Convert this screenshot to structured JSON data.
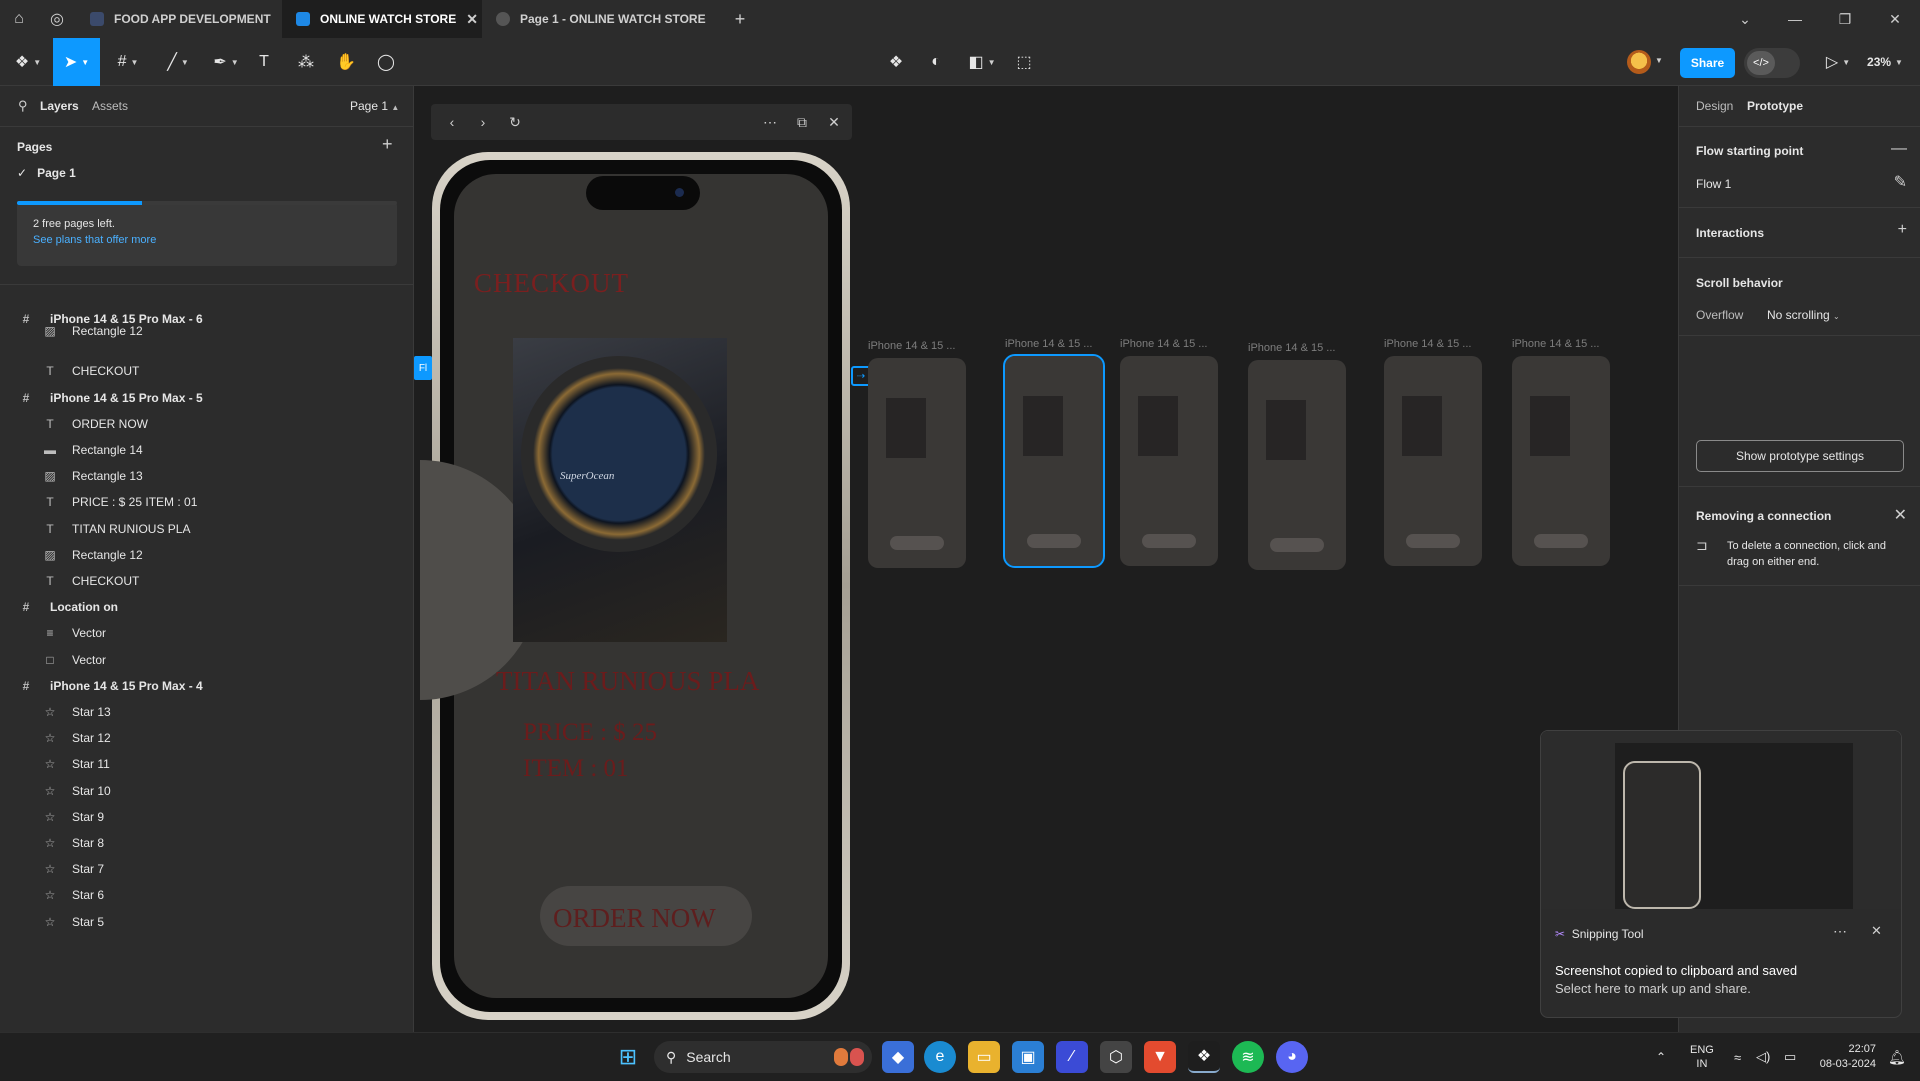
{
  "titlebar": {
    "tabs": [
      {
        "label": "FOOD APP DEVELOPMENT",
        "active": false
      },
      {
        "label": "ONLINE WATCH STORE",
        "active": true
      },
      {
        "label": "Page 1 - ONLINE WATCH STORE",
        "active": false
      }
    ]
  },
  "toolbar": {
    "share_label": "Share",
    "zoom": "23%"
  },
  "left_panel": {
    "tabs": [
      "Layers",
      "Assets"
    ],
    "page_selector": "Page 1",
    "pages_title": "Pages",
    "current_page": "Page 1",
    "plan": {
      "text": "2 free pages left.",
      "link": "See plans that offer more",
      "progress": 0.33
    },
    "layers": [
      {
        "type": "frame",
        "icon": "#",
        "label": "iPhone 14 & 15 Pro Max - 6"
      },
      {
        "type": "child",
        "icon": "img",
        "label": "Rectangle 12"
      },
      {
        "type": "child",
        "icon": "T",
        "label": "CHECKOUT"
      },
      {
        "type": "frame",
        "icon": "#",
        "label": "iPhone 14 & 15 Pro Max - 5"
      },
      {
        "type": "child",
        "icon": "T",
        "label": "ORDER NOW"
      },
      {
        "type": "child",
        "icon": "rect",
        "label": "Rectangle 14"
      },
      {
        "type": "child",
        "icon": "img",
        "label": "Rectangle 13"
      },
      {
        "type": "child",
        "icon": "T",
        "label": "PRICE : $ 25 ITEM : 01"
      },
      {
        "type": "child",
        "icon": "T",
        "label": "TITAN RUNIOUS PLA"
      },
      {
        "type": "child",
        "icon": "img",
        "label": "Rectangle 12"
      },
      {
        "type": "child",
        "icon": "T",
        "label": "CHECKOUT"
      },
      {
        "type": "frame",
        "icon": "#",
        "label": "Location on"
      },
      {
        "type": "child",
        "icon": "vec",
        "label": "Vector"
      },
      {
        "type": "child",
        "icon": "box",
        "label": "Vector"
      },
      {
        "type": "frame",
        "icon": "#",
        "label": "iPhone 14 & 15 Pro Max - 4"
      },
      {
        "type": "child",
        "icon": "star",
        "label": "Star 13"
      },
      {
        "type": "child",
        "icon": "star",
        "label": "Star 12"
      },
      {
        "type": "child",
        "icon": "star",
        "label": "Star 11"
      },
      {
        "type": "child",
        "icon": "star",
        "label": "Star 10"
      },
      {
        "type": "child",
        "icon": "star",
        "label": "Star 9"
      },
      {
        "type": "child",
        "icon": "star",
        "label": "Star 8"
      },
      {
        "type": "child",
        "icon": "star",
        "label": "Star 7"
      },
      {
        "type": "child",
        "icon": "star",
        "label": "Star 6"
      },
      {
        "type": "child",
        "icon": "star",
        "label": "Star 5"
      }
    ]
  },
  "canvas": {
    "flow_badge": "Fl",
    "phone": {
      "checkout": "CHECKOUT",
      "product": "TITAN RUNIOUS PLA",
      "price": "PRICE :  $ 25",
      "item": "ITEM   :   01",
      "order": "ORDER NOW",
      "watch_brand": "SuperOcean"
    },
    "thumbnails": [
      {
        "label": "iPhone 14 & 15 ...",
        "selected": false
      },
      {
        "label": "iPhone 14 & 15 ...",
        "selected": true
      },
      {
        "label": "iPhone 14 & 15 ...",
        "selected": false
      },
      {
        "label": "iPhone 14 & 15 ...",
        "selected": false
      },
      {
        "label": "iPhone 14 & 15 ...",
        "selected": false
      },
      {
        "label": "iPhone 14 & 15 ...",
        "selected": false
      }
    ]
  },
  "right_panel": {
    "tabs": [
      "Design",
      "Prototype"
    ],
    "flow_start_title": "Flow starting point",
    "flow_name": "Flow 1",
    "interactions_title": "Interactions",
    "scroll_title": "Scroll behavior",
    "overflow_label": "Overflow",
    "overflow_value": "No scrolling",
    "settings_button": "Show prototype settings",
    "removing_title": "Removing a connection",
    "removing_text": "To delete a connection, click and drag on either end."
  },
  "toast": {
    "app": "Snipping Tool",
    "title": "Screenshot copied to clipboard and saved",
    "body": "Select here to mark up and share."
  },
  "taskbar": {
    "search": "Search",
    "lang_top": "ENG",
    "lang_bottom": "IN",
    "time": "22:07",
    "date": "08-03-2024"
  },
  "colors": {
    "accent": "#0d99ff",
    "panel": "#2c2c2c",
    "canvas": "#1e1e1e",
    "checkout_red": "#7a1f1f"
  }
}
